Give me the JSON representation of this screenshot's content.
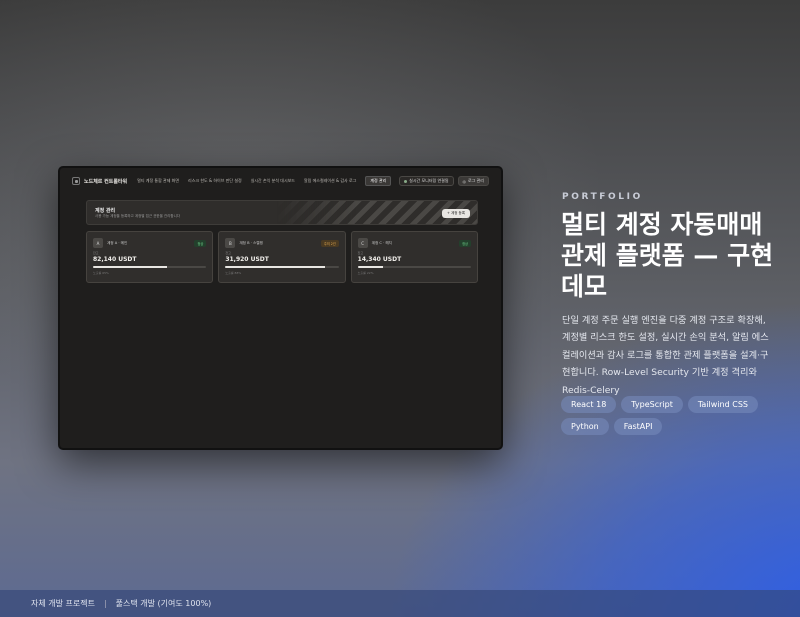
{
  "mock": {
    "nav": {
      "brand": "노드체르 컨트롤타워",
      "links": [
        "멀티 계정 통합 관제 화면",
        "리스크 한도 & 하이브 판단 설정",
        "실시간 손익 분석 대시보드",
        "알림 에스컬레이션 & 감사 로그"
      ],
      "active_link": "계정 관리",
      "status": "실시간 모니터링 연결됨",
      "login": "로그 관리"
    },
    "header": {
      "title": "계정 관리",
      "subtitle": "사용 가능 계정을 등록하고 계정별 접근 권한을 관리합니다",
      "button": "+ 계정 등록"
    },
    "cards": [
      {
        "initial": "A",
        "name": "계정 A · 메인",
        "badge": "정상",
        "badge_color": "green",
        "caption": "잔고",
        "value": "82,140 USDT",
        "progress": 0.65,
        "foot": "노출률 65%"
      },
      {
        "initial": "B",
        "name": "계정 B · 스캘핑",
        "badge": "주의 2건",
        "badge_color": "orange",
        "caption": "잔고",
        "value": "31,920 USDT",
        "progress": 0.88,
        "foot": "노출률 88%"
      },
      {
        "initial": "C",
        "name": "계정 C · 헤지",
        "badge": "정상",
        "badge_color": "green",
        "caption": "잔고",
        "value": "14,340 USDT",
        "progress": 0.22,
        "foot": "노출률 22%"
      }
    ]
  },
  "portfolio": {
    "eyebrow": "PORTFOLIO",
    "title": "멀티 계정 자동매매 관제 플랫폼 — 구현 데모",
    "description": "단일 계정 주문 실행 엔진을 다중 계정 구조로 확장해, 계정별 리스크 한도 설정, 실시간 손익 분석, 알림 에스컬레이션과 감사 로그를 통합한 관제 플랫폼을 설계·구현합니다. Row-Level Security 기반 계정 격리와 Redis-Celery",
    "tags": [
      "React 18",
      "TypeScript",
      "Tailwind CSS",
      "Python",
      "FastAPI"
    ]
  },
  "footer": {
    "left": "자체 개발 프로젝트",
    "separator": "|",
    "right": "풀스택 개발 (기여도 100%)"
  }
}
